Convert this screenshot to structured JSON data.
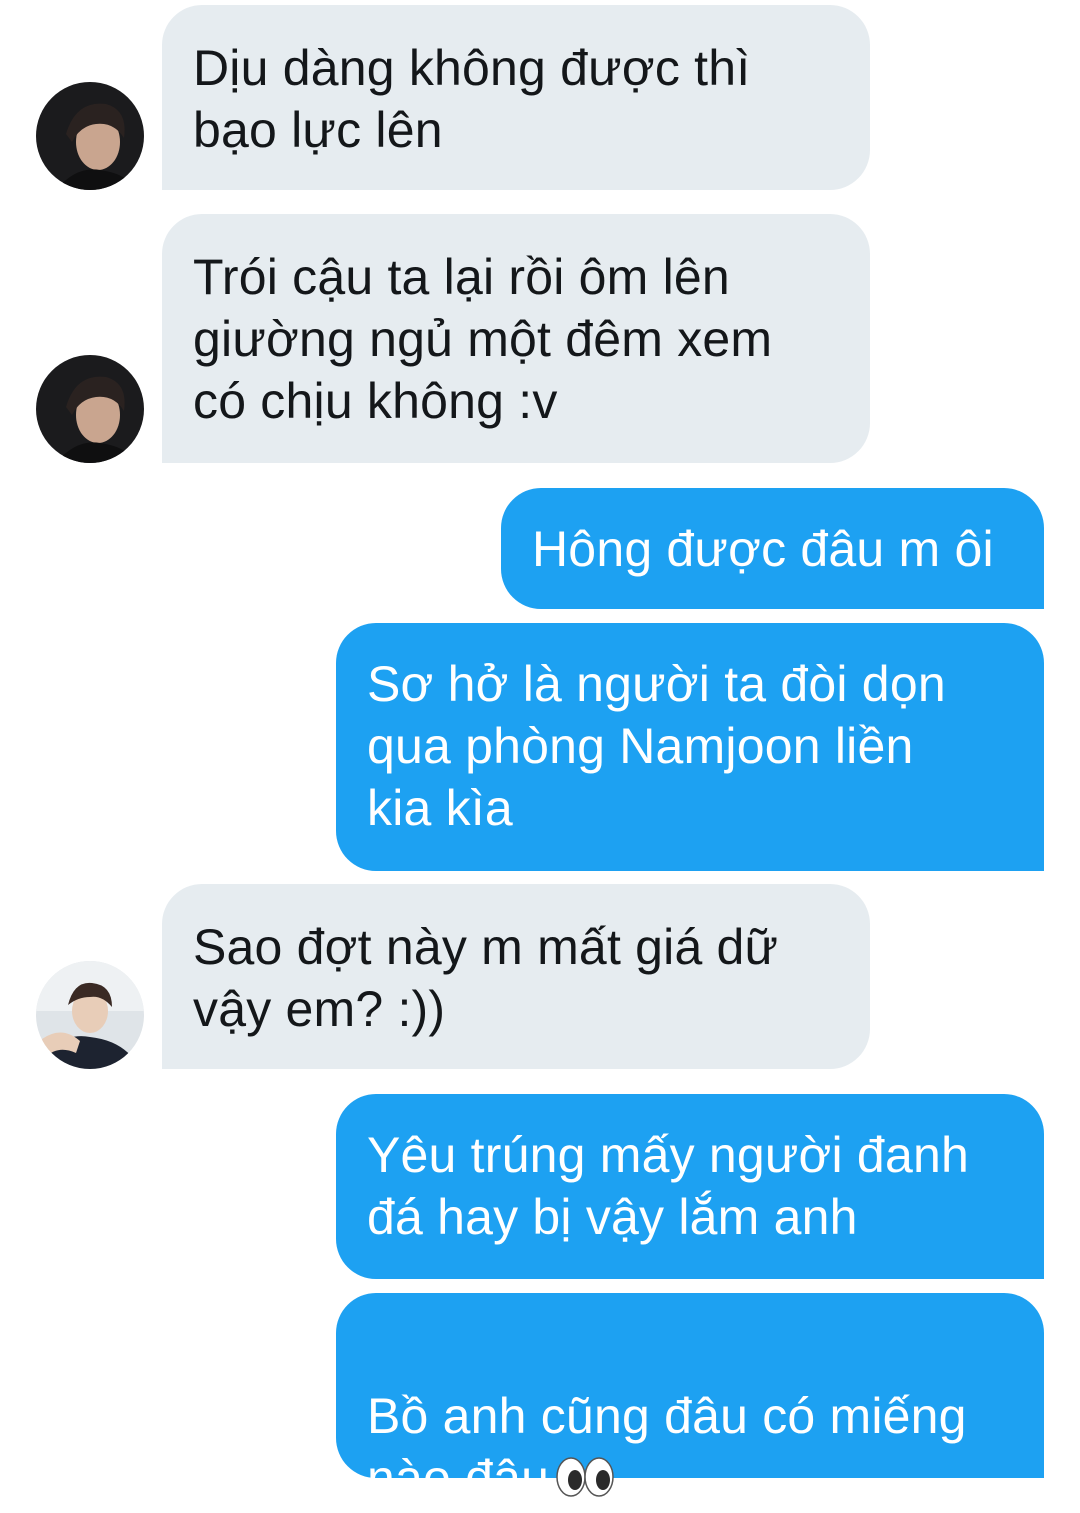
{
  "messages": [
    {
      "direction": "incoming",
      "text": "Dịu dàng không được thì\nbạo lực lên"
    },
    {
      "direction": "incoming",
      "text": "Trói cậu ta lại rồi ôm lên\ngiường ngủ một đêm xem\ncó chịu không :v"
    },
    {
      "direction": "outgoing",
      "text": "Hông được đâu m ôi"
    },
    {
      "direction": "outgoing",
      "text": "Sơ hở là người ta đòi dọn\nqua phòng Namjoon liền\nkia kìa"
    },
    {
      "direction": "incoming",
      "text": "Sao đợt này m mất giá dữ\nvậy em? :))"
    },
    {
      "direction": "outgoing",
      "text": "Yêu trúng mấy người đanh\nđá hay bị vậy lắm anh"
    },
    {
      "direction": "outgoing",
      "text": "Bồ anh cũng đâu có miếng\nnào đâu",
      "emoji": "eyes-emoji"
    }
  ],
  "colors": {
    "incoming_bubble": "#e6ecf0",
    "incoming_text": "#14171a",
    "outgoing_bubble": "#1da1f2",
    "outgoing_text": "#ffffff",
    "background": "#ffffff"
  }
}
